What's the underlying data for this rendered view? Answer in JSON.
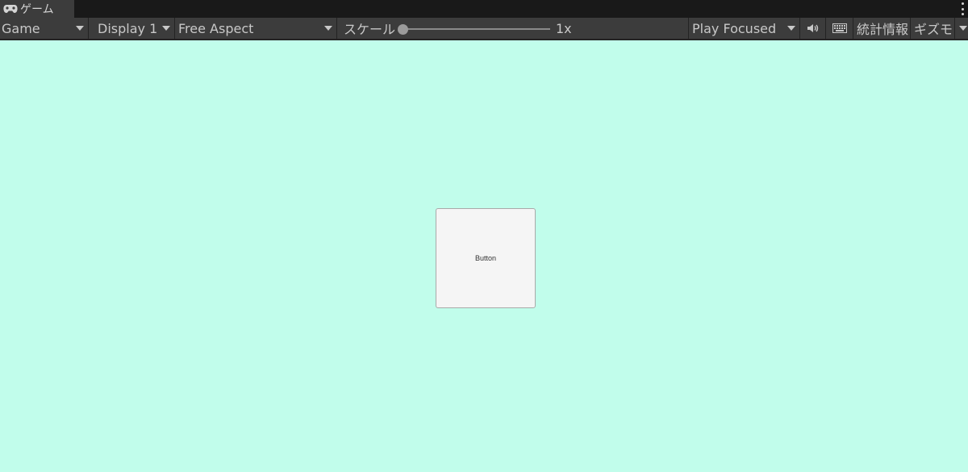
{
  "tab": {
    "icon": "gamepad-icon",
    "label": "ゲーム"
  },
  "toolbar": {
    "view_mode": "Game",
    "display": "Display 1",
    "aspect": "Free Aspect",
    "scale_label": "スケール",
    "scale_value": "1x",
    "scale_fraction": 0,
    "play_mode": "Play Focused",
    "audio_icon": "speaker-icon",
    "keyboard_icon": "keyboard-icon",
    "stats_label": "統計情報",
    "gizmos_label": "ギズモ"
  },
  "game": {
    "background_color": "#c1fdeb",
    "button_label": "Button"
  }
}
